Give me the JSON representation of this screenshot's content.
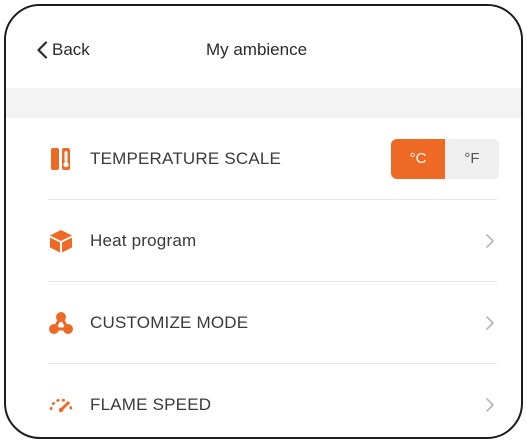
{
  "header": {
    "back_label": "Back",
    "title": "My ambience"
  },
  "colors": {
    "accent": "#ee6a24",
    "text": "#3a3a3a",
    "band": "#f3f3f3",
    "divider": "#e6e6e6"
  },
  "settings": [
    {
      "label": "TEMPERATURE SCALE",
      "icon": "thermometer-icon",
      "control": "segmented"
    },
    {
      "label": "Heat program",
      "icon": "cube-icon",
      "control": "chevron"
    },
    {
      "label": "CUSTOMIZE MODE",
      "icon": "molecule-icon",
      "control": "chevron"
    },
    {
      "label": "FLAME SPEED",
      "icon": "gauge-icon",
      "control": "chevron"
    }
  ],
  "temperature_scale": {
    "options": [
      "°C",
      "°F"
    ],
    "selected": "°C"
  }
}
